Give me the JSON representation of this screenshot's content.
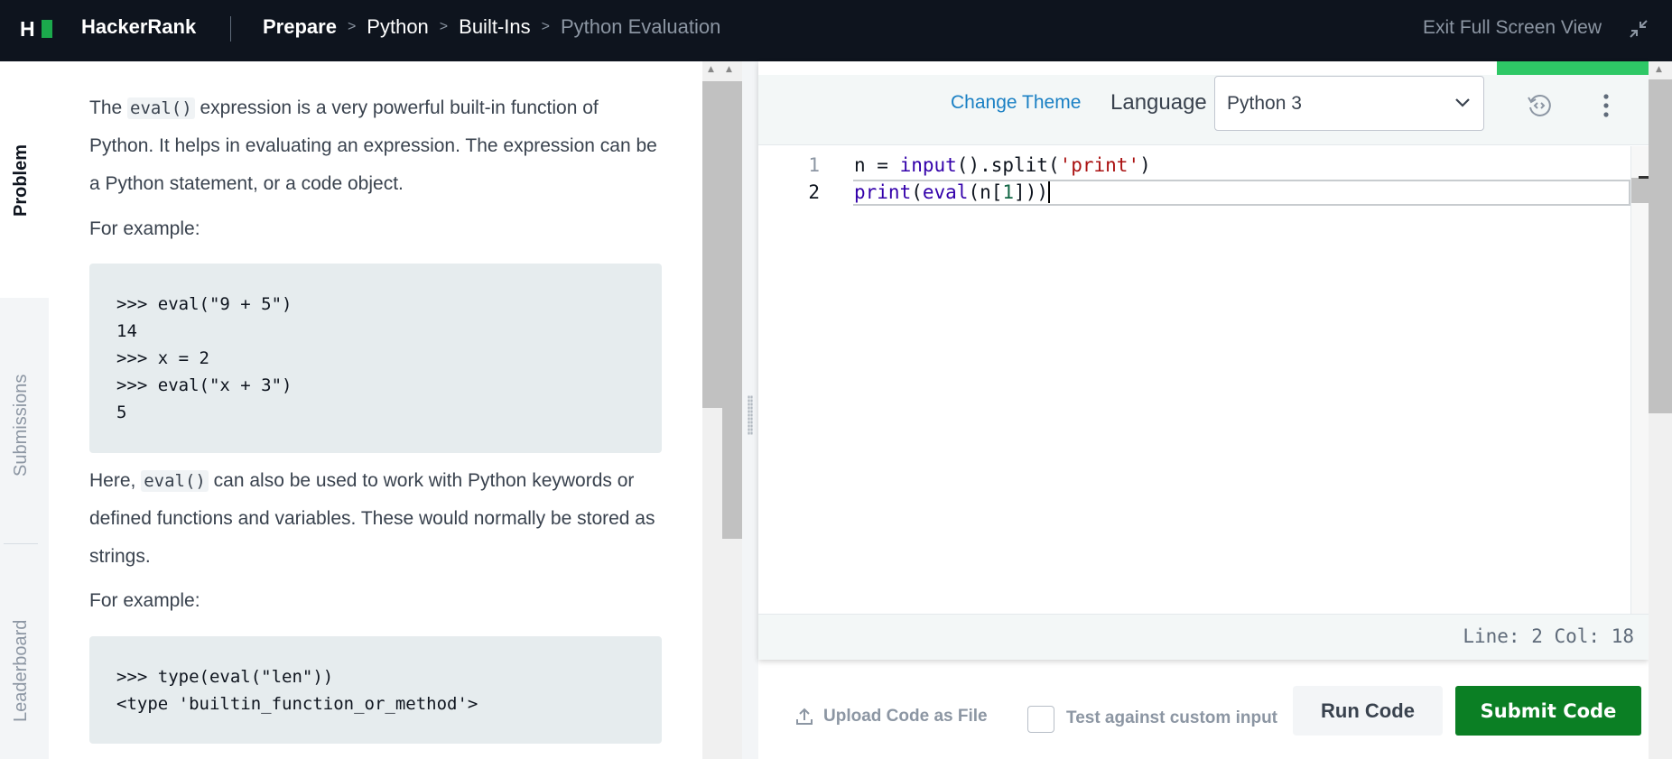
{
  "header": {
    "brand": "HackerRank",
    "breadcrumbs": [
      {
        "label": "Prepare"
      },
      {
        "label": "Python"
      },
      {
        "label": "Built-Ins"
      },
      {
        "label": "Python Evaluation"
      }
    ],
    "exit_label": "Exit Full Screen View"
  },
  "sidebar_tabs": {
    "problem": "Problem",
    "submissions": "Submissions",
    "leaderboard": "Leaderboard"
  },
  "problem": {
    "p1_before": "The ",
    "p1_code": "eval()",
    "p1_after": " expression is a very powerful built-in function of Python. It helps in evaluating an expression. The expression can be a Python statement, or a code object.",
    "for_example_1": "For example:",
    "code_block_1": ">>> eval(\"9 + 5\")\n14\n>>> x = 2\n>>> eval(\"x + 3\")\n5",
    "p2_before": "Here, ",
    "p2_code": "eval()",
    "p2_after": " can also be used to work with Python keywords or defined functions and variables. These would normally be stored as strings.",
    "for_example_2": "For example:",
    "code_block_2": ">>> type(eval(\"len\"))\n<type 'builtin_function_or_method'>"
  },
  "editor": {
    "change_theme": "Change Theme",
    "language_label": "Language",
    "language_value": "Python 3",
    "line_numbers": [
      "1",
      "2"
    ],
    "code": {
      "l1_a": "n = ",
      "l1_input": "input",
      "l1_b": "().split(",
      "l1_str": "'print'",
      "l1_c": ")",
      "l2_print": "print",
      "l2_b": "(",
      "l2_eval": "eval",
      "l2_c": "(n[",
      "l2_num": "1",
      "l2_d": "]))"
    },
    "status": "Line: 2 Col: 18"
  },
  "actions": {
    "upload_label": "Upload Code as File",
    "custom_input_label": "Test against custom input",
    "run_label": "Run Code",
    "submit_label": "Submit Code"
  },
  "colors": {
    "topbar_bg": "#0e141e",
    "brand_green": "#1ba94c",
    "submit_green": "#0b7f24",
    "link_blue": "#1a80c4"
  }
}
